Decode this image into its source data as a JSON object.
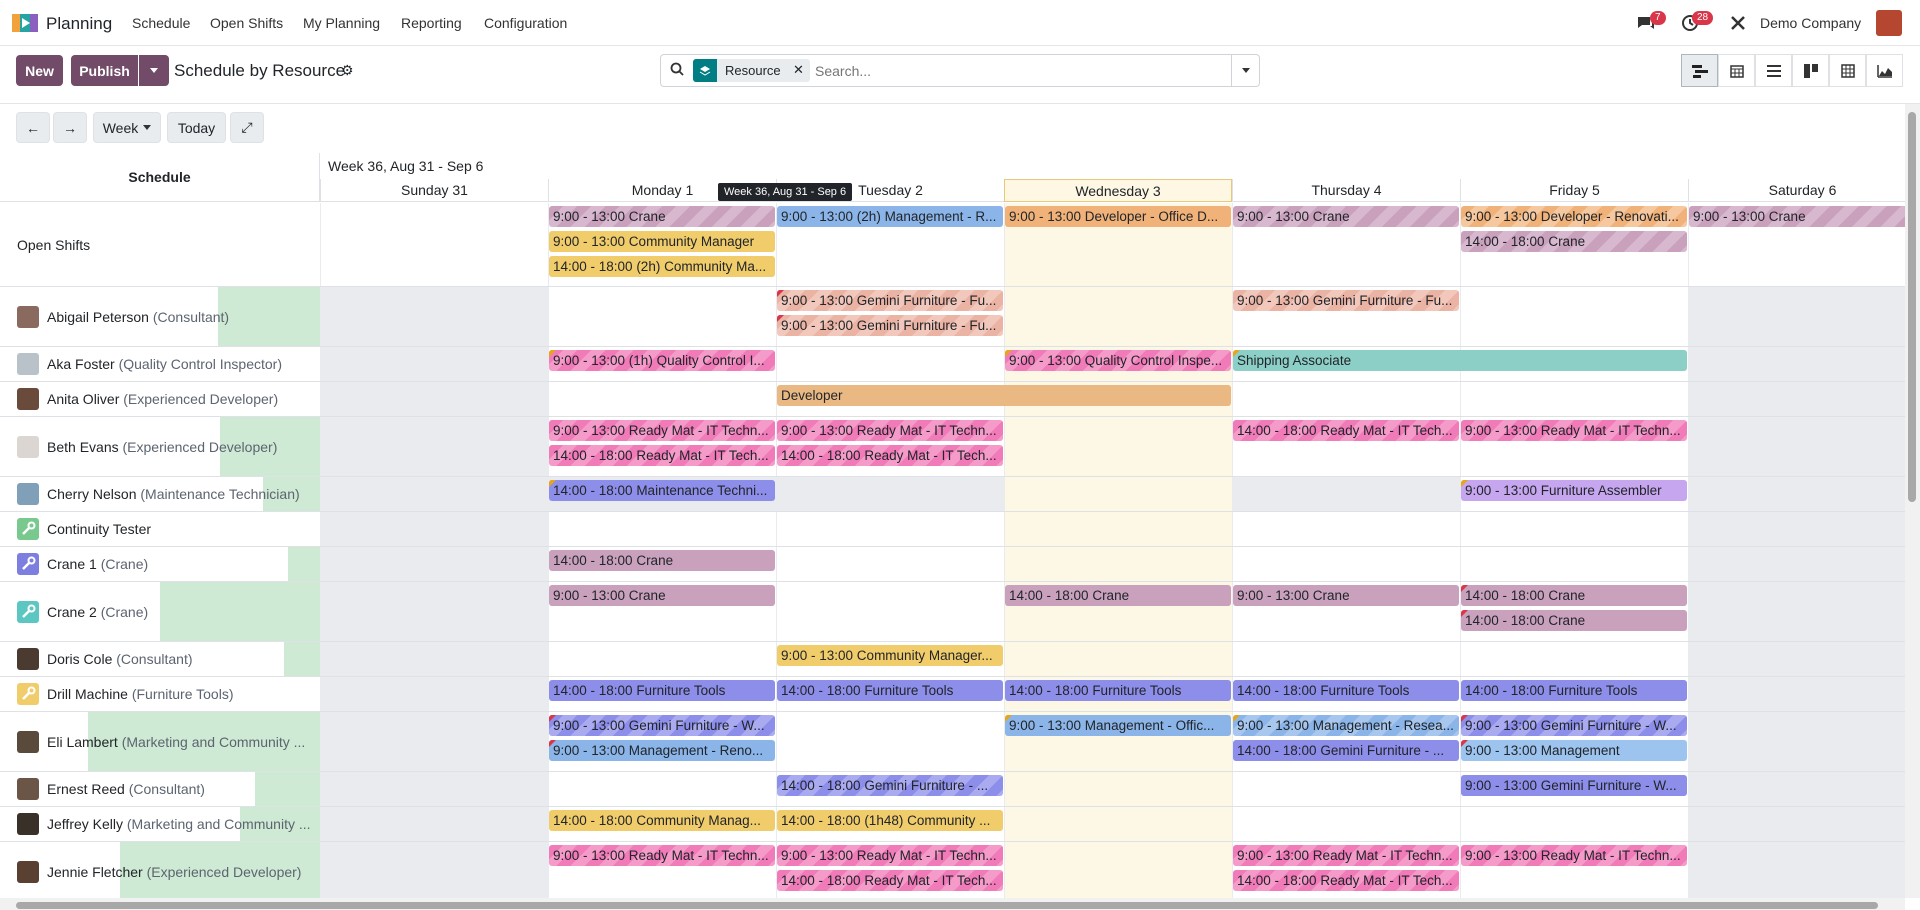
{
  "navbar": {
    "app_name": "Planning",
    "menu": [
      "Schedule",
      "Open Shifts",
      "My Planning",
      "Reporting",
      "Configuration"
    ],
    "messages_count": "7",
    "activities_count": "28",
    "company": "Demo Company"
  },
  "control": {
    "new_label": "New",
    "publish_label": "Publish",
    "title": "Schedule by Resource",
    "facet_label": "Resource",
    "search_placeholder": "Search...",
    "scale_label": "Week",
    "today_label": "Today"
  },
  "gantt": {
    "week_title": "Week 36, Aug 31 - Sep 6",
    "schedule_header": "Schedule",
    "tooltip": "Week 36, Aug 31 - Sep 6",
    "days": [
      "Sunday 31",
      "Monday 1",
      "Tuesday 2",
      "Wednesday 3",
      "Thursday 4",
      "Friday 5",
      "Saturday 6"
    ],
    "rows": [
      {
        "name": "Open Shifts",
        "role": "",
        "pills": [
          {
            "text": "9:00 - 13:00 Crane",
            "day": 1,
            "span": 1,
            "lane": 0,
            "color": "crane-s"
          },
          {
            "text": "9:00 - 13:00 Community Manager",
            "day": 1,
            "span": 1,
            "lane": 1,
            "color": "yellow"
          },
          {
            "text": "14:00 - 18:00 (2h) Community Ma...",
            "day": 1,
            "span": 1,
            "lane": 2,
            "color": "yellow"
          },
          {
            "text": "9:00 - 13:00 (2h) Management - R...",
            "day": 2,
            "span": 1,
            "lane": 0,
            "color": "blue"
          },
          {
            "text": "9:00 - 13:00 Developer - Office D...",
            "day": 3,
            "span": 1,
            "lane": 0,
            "color": "orange"
          },
          {
            "text": "9:00 - 13:00 Crane",
            "day": 4,
            "span": 1,
            "lane": 0,
            "color": "crane-s"
          },
          {
            "text": "9:00 - 13:00 Developer - Renovati...",
            "day": 5,
            "span": 1,
            "lane": 0,
            "color": "orange-s"
          },
          {
            "text": "14:00 - 18:00 Crane",
            "day": 5,
            "span": 1,
            "lane": 1,
            "color": "crane-s"
          },
          {
            "text": "9:00 - 13:00 Crane",
            "day": 6,
            "span": 1,
            "lane": 0,
            "color": "crane-s"
          }
        ]
      },
      {
        "name": "Abigail Peterson",
        "role": "(Consultant)",
        "pills": [
          {
            "text": "9:00 - 13:00 Gemini Furniture - Fu...",
            "day": 2,
            "span": 1,
            "lane": 0,
            "color": "salmon",
            "corner": "r"
          },
          {
            "text": "9:00 - 13:00 Gemini Furniture - Fu...",
            "day": 2,
            "span": 1,
            "lane": 1,
            "color": "salmon",
            "corner": "r"
          },
          {
            "text": "9:00 - 13:00 Gemini Furniture - Fu...",
            "day": 4,
            "span": 1,
            "lane": 0,
            "color": "salmon"
          }
        ]
      },
      {
        "name": "Aka Foster",
        "role": "(Quality Control Inspector)",
        "pills": [
          {
            "text": "9:00 - 13:00 (1h) Quality Control I...",
            "day": 1,
            "span": 1,
            "lane": 0,
            "color": "pink",
            "corner": "y"
          },
          {
            "text": "9:00 - 13:00 Quality Control Inspe...",
            "day": 3,
            "span": 1,
            "lane": 0,
            "color": "pink",
            "corner": "y"
          },
          {
            "text": "Shipping Associate",
            "day": 4,
            "span": 2,
            "lane": 0,
            "color": "teal",
            "corner": "y"
          }
        ]
      },
      {
        "name": "Anita Oliver",
        "role": "(Experienced Developer)",
        "pills": [
          {
            "text": "Developer",
            "day": 2,
            "span": 2,
            "lane": 0,
            "color": "tan"
          }
        ]
      },
      {
        "name": "Beth Evans",
        "role": "(Experienced Developer)",
        "pills": [
          {
            "text": "9:00 - 13:00 Ready Mat - IT Techn...",
            "day": 1,
            "span": 1,
            "lane": 0,
            "color": "pink"
          },
          {
            "text": "14:00 - 18:00 Ready Mat - IT Tech...",
            "day": 1,
            "span": 1,
            "lane": 1,
            "color": "pink"
          },
          {
            "text": "9:00 - 13:00 Ready Mat - IT Techn...",
            "day": 2,
            "span": 1,
            "lane": 0,
            "color": "pink"
          },
          {
            "text": "14:00 - 18:00 Ready Mat - IT Tech...",
            "day": 2,
            "span": 1,
            "lane": 1,
            "color": "pink"
          },
          {
            "text": "14:00 - 18:00 Ready Mat - IT Tech...",
            "day": 4,
            "span": 1,
            "lane": 0,
            "color": "pink"
          },
          {
            "text": "9:00 - 13:00 Ready Mat - IT Techn...",
            "day": 5,
            "span": 1,
            "lane": 0,
            "color": "pink"
          }
        ]
      },
      {
        "name": "Cherry Nelson",
        "role": "(Maintenance Technician)",
        "pills": [
          {
            "text": "14:00 - 18:00 Maintenance Techni...",
            "day": 1,
            "span": 1,
            "lane": 0,
            "color": "purple",
            "corner": "y"
          },
          {
            "text": "9:00 - 13:00 Furniture Assembler",
            "day": 5,
            "span": 1,
            "lane": 0,
            "color": "lav",
            "corner": "y"
          }
        ]
      },
      {
        "name": "Continuity Tester",
        "role": "",
        "pills": []
      },
      {
        "name": "Crane 1",
        "role": "(Crane)",
        "pills": [
          {
            "text": "14:00 - 18:00 Crane",
            "day": 1,
            "span": 1,
            "lane": 0,
            "color": "crane"
          }
        ]
      },
      {
        "name": "Crane 2",
        "role": "(Crane)",
        "pills": [
          {
            "text": "9:00 - 13:00 Crane",
            "day": 1,
            "span": 1,
            "lane": 0,
            "color": "crane"
          },
          {
            "text": "14:00 - 18:00 Crane",
            "day": 3,
            "span": 1,
            "lane": 0,
            "color": "crane"
          },
          {
            "text": "9:00 - 13:00 Crane",
            "day": 4,
            "span": 1,
            "lane": 0,
            "color": "crane"
          },
          {
            "text": "14:00 - 18:00 Crane",
            "day": 5,
            "span": 1,
            "lane": 0,
            "color": "crane",
            "corner": "r"
          },
          {
            "text": "14:00 - 18:00 Crane",
            "day": 5,
            "span": 1,
            "lane": 1,
            "color": "crane",
            "corner": "r"
          }
        ]
      },
      {
        "name": "Doris Cole",
        "role": "(Consultant)",
        "pills": [
          {
            "text": "9:00 - 13:00 Community Manager...",
            "day": 2,
            "span": 1,
            "lane": 0,
            "color": "yellow"
          }
        ]
      },
      {
        "name": "Drill Machine",
        "role": "(Furniture Tools)",
        "pills": [
          {
            "text": "14:00 - 18:00 Furniture Tools",
            "day": 1,
            "span": 1,
            "lane": 0,
            "color": "purple"
          },
          {
            "text": "14:00 - 18:00 Furniture Tools",
            "day": 2,
            "span": 1,
            "lane": 0,
            "color": "purple"
          },
          {
            "text": "14:00 - 18:00 Furniture Tools",
            "day": 3,
            "span": 1,
            "lane": 0,
            "color": "purple"
          },
          {
            "text": "14:00 - 18:00 Furniture Tools",
            "day": 4,
            "span": 1,
            "lane": 0,
            "color": "purple"
          },
          {
            "text": "14:00 - 18:00 Furniture Tools",
            "day": 5,
            "span": 1,
            "lane": 0,
            "color": "purple"
          }
        ]
      },
      {
        "name": "Eli Lambert",
        "role": "(Marketing and Community ...",
        "pills": [
          {
            "text": "9:00 - 13:00 Gemini Furniture - W...",
            "day": 1,
            "span": 1,
            "lane": 0,
            "color": "purple-s",
            "corner": "r"
          },
          {
            "text": "9:00 - 13:00 Management - Reno...",
            "day": 1,
            "span": 1,
            "lane": 1,
            "color": "blue",
            "corner": "r"
          },
          {
            "text": "9:00 - 13:00 Management - Offic...",
            "day": 3,
            "span": 1,
            "lane": 0,
            "color": "blue",
            "corner": "y"
          },
          {
            "text": "9:00 - 13:00 Management - Resea...",
            "day": 4,
            "span": 1,
            "lane": 0,
            "color": "blue-s",
            "corner": "y"
          },
          {
            "text": "14:00 - 18:00 Gemini Furniture - ...",
            "day": 4,
            "span": 1,
            "lane": 1,
            "color": "purple"
          },
          {
            "text": "9:00 - 13:00 Gemini Furniture - W...",
            "day": 5,
            "span": 1,
            "lane": 0,
            "color": "purple-s",
            "corner": "r"
          },
          {
            "text": "9:00 - 13:00 Management",
            "day": 5,
            "span": 1,
            "lane": 1,
            "color": "lblue",
            "corner": "r"
          }
        ]
      },
      {
        "name": "Ernest Reed",
        "role": "(Consultant)",
        "pills": [
          {
            "text": "14:00 - 18:00 Gemini Furniture - ...",
            "day": 2,
            "span": 1,
            "lane": 0,
            "color": "purple-s"
          },
          {
            "text": "9:00 - 13:00 Gemini Furniture - W...",
            "day": 5,
            "span": 1,
            "lane": 0,
            "color": "purple"
          }
        ]
      },
      {
        "name": "Jeffrey Kelly",
        "role": "(Marketing and Community ...",
        "pills": [
          {
            "text": "14:00 - 18:00 Community Manag...",
            "day": 1,
            "span": 1,
            "lane": 0,
            "color": "yellow"
          },
          {
            "text": "14:00 - 18:00 (1h48) Community ...",
            "day": 2,
            "span": 1,
            "lane": 0,
            "color": "yellow"
          }
        ]
      },
      {
        "name": "Jennie Fletcher",
        "role": "(Experienced Developer)",
        "pills": [
          {
            "text": "9:00 - 13:00 Ready Mat - IT Techn...",
            "day": 1,
            "span": 1,
            "lane": 0,
            "color": "pink"
          },
          {
            "text": "9:00 - 13:00 Ready Mat - IT Techn...",
            "day": 2,
            "span": 1,
            "lane": 0,
            "color": "pink"
          },
          {
            "text": "14:00 - 18:00 Ready Mat - IT Tech...",
            "day": 2,
            "span": 1,
            "lane": 1,
            "color": "pink"
          },
          {
            "text": "9:00 - 13:00 Ready Mat - IT Techn...",
            "day": 4,
            "span": 1,
            "lane": 0,
            "color": "pink"
          },
          {
            "text": "14:00 - 18:00 Ready Mat - IT Tech...",
            "day": 4,
            "span": 1,
            "lane": 1,
            "color": "pink"
          },
          {
            "text": "9:00 - 13:00 Ready Mat - IT Techn...",
            "day": 5,
            "span": 1,
            "lane": 0,
            "color": "pink"
          }
        ]
      }
    ]
  }
}
